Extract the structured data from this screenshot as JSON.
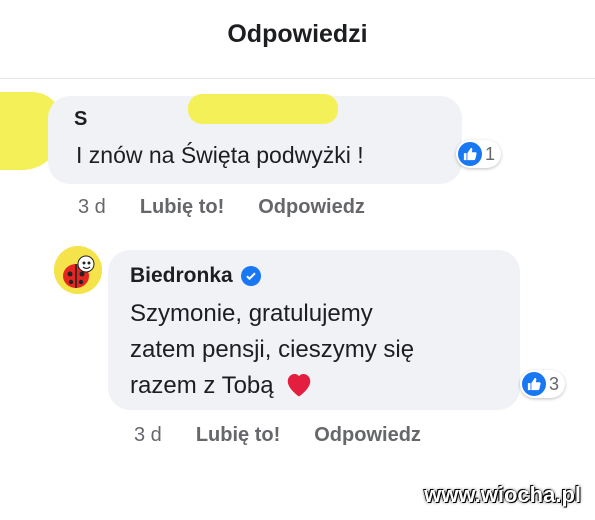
{
  "header": {
    "title": "Odpowiedzi"
  },
  "comment": {
    "author_partial": "S",
    "text": "I znów na Święta podwyżki !",
    "reactions": 1,
    "time": "3 d",
    "like_label": "Lubię to!",
    "reply_label": "Odpowiedz"
  },
  "reply": {
    "author": "Biedronka",
    "text_lines": [
      "Szymonie, gratulujemy",
      "zatem pensji, cieszymy się",
      "razem z Tobą"
    ],
    "reactions": 3,
    "time": "3 d",
    "like_label": "Lubię to!",
    "reply_label": "Odpowiedz"
  },
  "watermark": "www.wiocha.pl",
  "colors": {
    "facebook_blue": "#1877f2",
    "bubble_bg": "#f0f2f5",
    "secondary_text": "#65676b",
    "heart": "#e41e3f",
    "scribble": "#f4f058"
  }
}
